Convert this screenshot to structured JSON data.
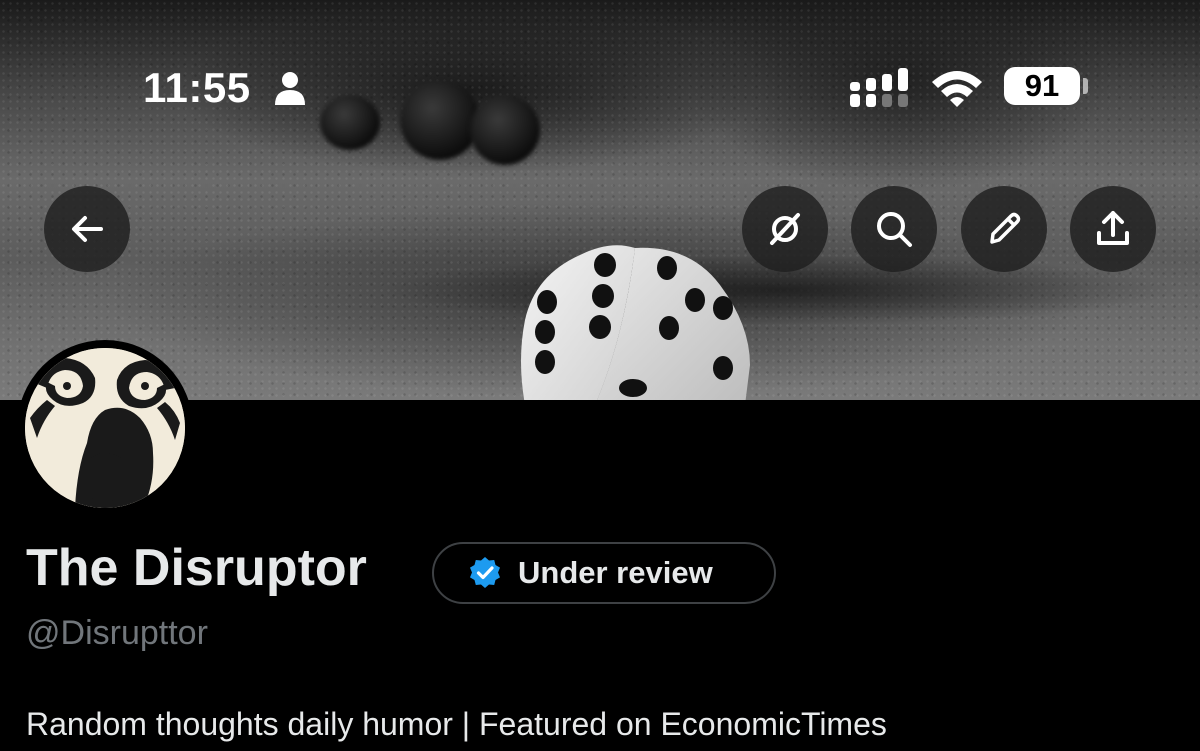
{
  "status_bar": {
    "time": "11:55",
    "battery": "91",
    "person_icon": "person-icon",
    "signal_icon": "cellular-signal-icon",
    "wifi_icon": "wifi-icon"
  },
  "header_actions": {
    "back_icon": "back-arrow-icon",
    "grok_icon": "grok-icon",
    "search_icon": "search-icon",
    "edit_icon": "pencil-icon",
    "share_icon": "share-icon"
  },
  "profile": {
    "display_name": "The Disruptor",
    "verification_label": "Under review",
    "handle": "@Disrupttor",
    "bio": "Random thoughts daily humor | Featured on EconomicTimes"
  },
  "colors": {
    "background": "#000000",
    "text_primary": "#e7e9ea",
    "text_secondary": "#71767b",
    "verified_blue": "#1d9bf0",
    "chip_border": "#3e4144"
  }
}
